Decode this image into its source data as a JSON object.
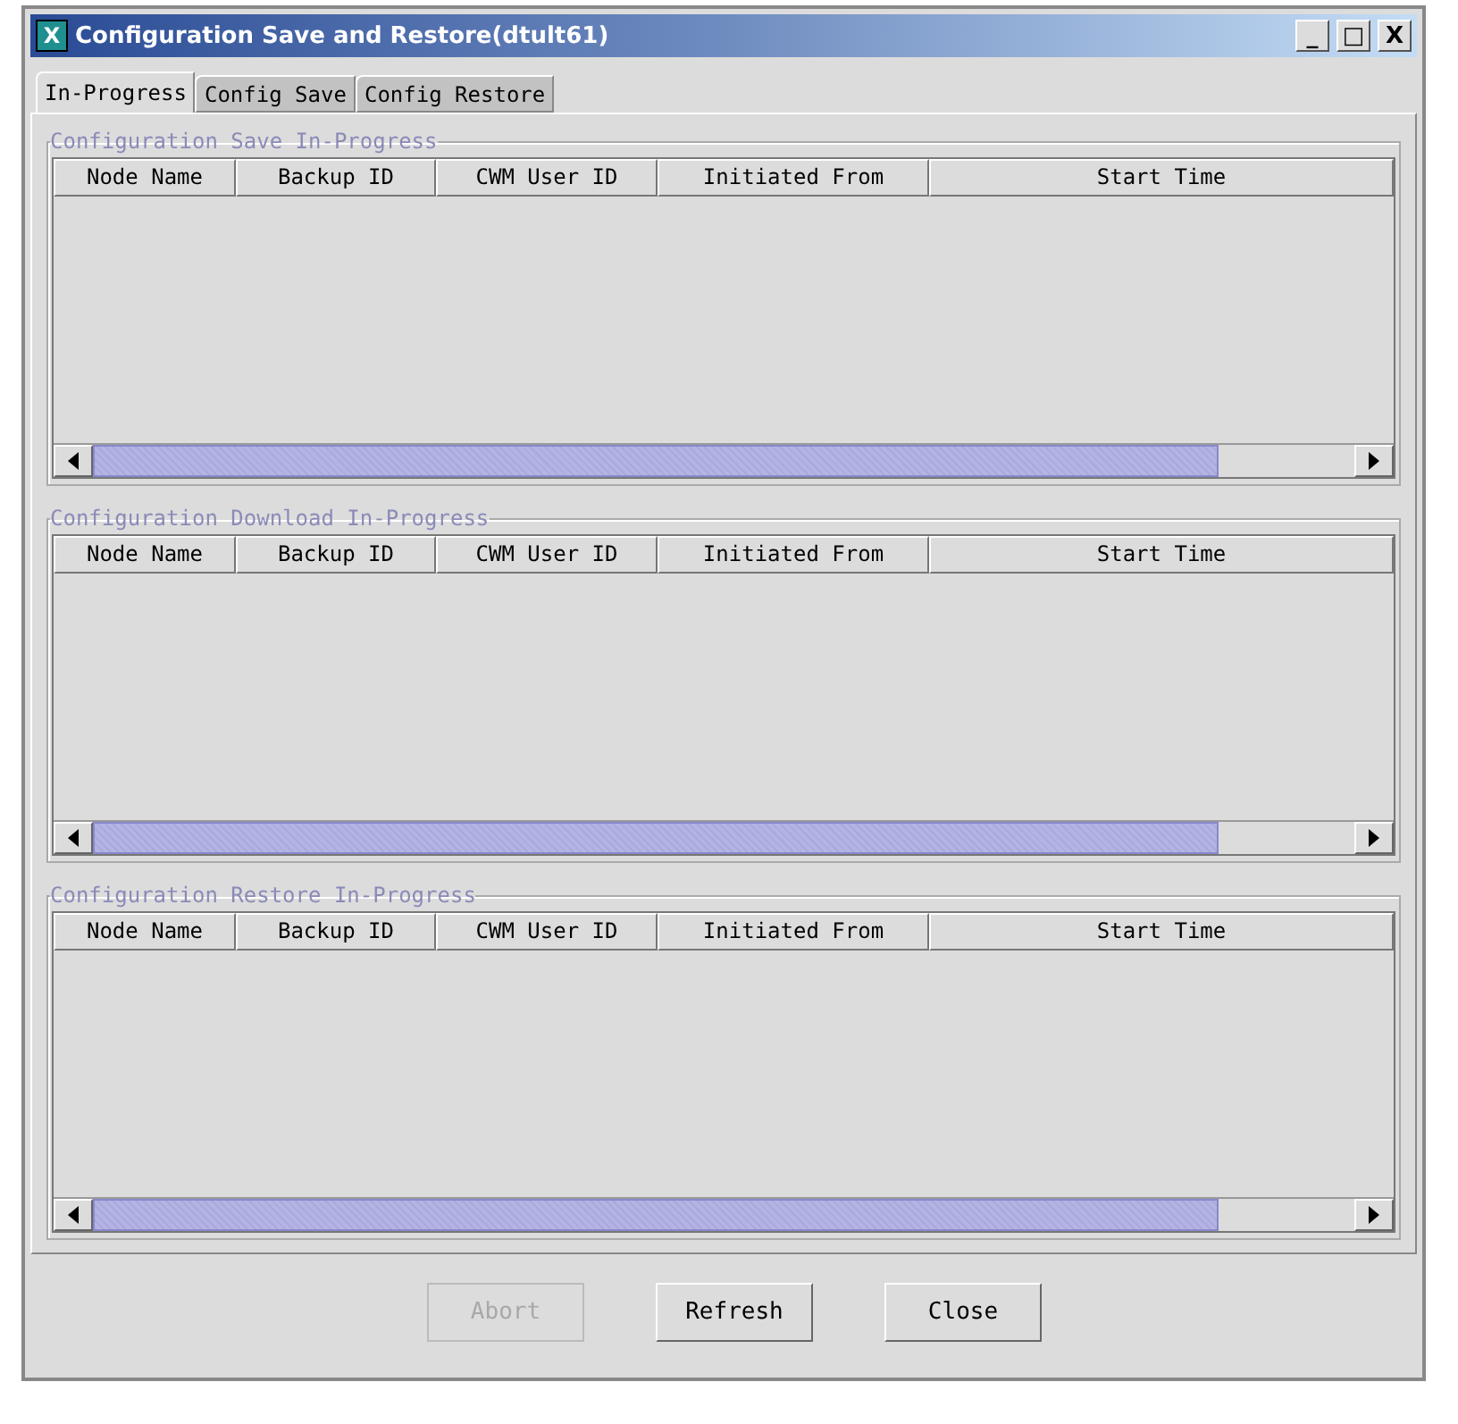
{
  "window": {
    "title": "Configuration Save and Restore(dtult61)",
    "icon_letter": "X",
    "controls": [
      "_",
      "□",
      "X"
    ]
  },
  "tabs": [
    {
      "label": "In-Progress",
      "selected": true
    },
    {
      "label": "Config Save",
      "selected": false
    },
    {
      "label": "Config Restore",
      "selected": false
    }
  ],
  "groups": [
    {
      "title": "Configuration Save In-Progress",
      "columns": [
        "Node Name",
        "Backup ID",
        "CWM User ID",
        "Initiated From",
        "Start Time"
      ]
    },
    {
      "title": "Configuration Download In-Progress",
      "columns": [
        "Node Name",
        "Backup ID",
        "CWM User ID",
        "Initiated From",
        "Start Time"
      ]
    },
    {
      "title": "Configuration Restore In-Progress",
      "columns": [
        "Node Name",
        "Backup ID",
        "CWM User ID",
        "Initiated From",
        "Start Time"
      ]
    }
  ],
  "buttons": [
    {
      "label": "Abort",
      "disabled": true
    },
    {
      "label": "Refresh",
      "disabled": false
    },
    {
      "label": "Close",
      "disabled": false
    }
  ]
}
